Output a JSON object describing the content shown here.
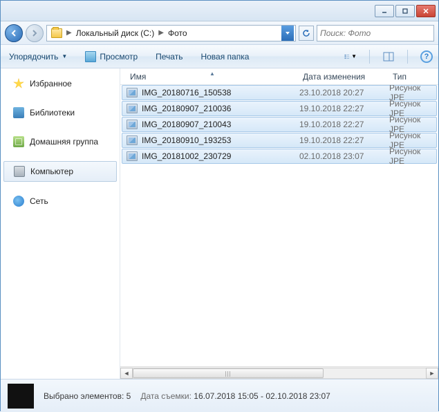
{
  "breadcrumb": {
    "seg1": "Локальный диск (C:)",
    "seg2": "Фото"
  },
  "search": {
    "placeholder": "Поиск: Фото"
  },
  "toolbar": {
    "organize": "Упорядочить",
    "view": "Просмотр",
    "print": "Печать",
    "newfolder": "Новая папка"
  },
  "sidebar": {
    "favorites": "Избранное",
    "libraries": "Библиотеки",
    "homegroup": "Домашняя группа",
    "computer": "Компьютер",
    "network": "Сеть"
  },
  "columns": {
    "name": "Имя",
    "date": "Дата изменения",
    "type": "Тип"
  },
  "files": [
    {
      "name": "IMG_20180716_150538",
      "date": "23.10.2018 20:27",
      "type": "Рисунок JPE"
    },
    {
      "name": "IMG_20180907_210036",
      "date": "19.10.2018 22:27",
      "type": "Рисунок JPE"
    },
    {
      "name": "IMG_20180907_210043",
      "date": "19.10.2018 22:27",
      "type": "Рисунок JPE"
    },
    {
      "name": "IMG_20180910_193253",
      "date": "19.10.2018 22:27",
      "type": "Рисунок JPE"
    },
    {
      "name": "IMG_20181002_230729",
      "date": "02.10.2018 23:07",
      "type": "Рисунок JPE"
    }
  ],
  "status": {
    "selected": "Выбрано элементов: 5",
    "shot_label": "Дата съемки:",
    "shot_value": "16.07.2018 15:05 - 02.10.2018 23:07"
  }
}
